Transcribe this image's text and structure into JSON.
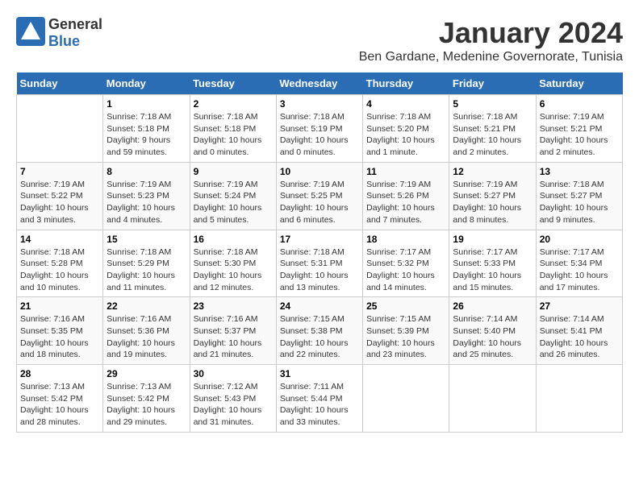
{
  "header": {
    "logo_general": "General",
    "logo_blue": "Blue",
    "month_title": "January 2024",
    "location": "Ben Gardane, Medenine Governorate, Tunisia"
  },
  "weekdays": [
    "Sunday",
    "Monday",
    "Tuesday",
    "Wednesday",
    "Thursday",
    "Friday",
    "Saturday"
  ],
  "weeks": [
    [
      {
        "day": "",
        "sunrise": "",
        "sunset": "",
        "daylight": ""
      },
      {
        "day": "1",
        "sunrise": "Sunrise: 7:18 AM",
        "sunset": "Sunset: 5:18 PM",
        "daylight": "Daylight: 9 hours and 59 minutes."
      },
      {
        "day": "2",
        "sunrise": "Sunrise: 7:18 AM",
        "sunset": "Sunset: 5:18 PM",
        "daylight": "Daylight: 10 hours and 0 minutes."
      },
      {
        "day": "3",
        "sunrise": "Sunrise: 7:18 AM",
        "sunset": "Sunset: 5:19 PM",
        "daylight": "Daylight: 10 hours and 0 minutes."
      },
      {
        "day": "4",
        "sunrise": "Sunrise: 7:18 AM",
        "sunset": "Sunset: 5:20 PM",
        "daylight": "Daylight: 10 hours and 1 minute."
      },
      {
        "day": "5",
        "sunrise": "Sunrise: 7:18 AM",
        "sunset": "Sunset: 5:21 PM",
        "daylight": "Daylight: 10 hours and 2 minutes."
      },
      {
        "day": "6",
        "sunrise": "Sunrise: 7:19 AM",
        "sunset": "Sunset: 5:21 PM",
        "daylight": "Daylight: 10 hours and 2 minutes."
      }
    ],
    [
      {
        "day": "7",
        "sunrise": "Sunrise: 7:19 AM",
        "sunset": "Sunset: 5:22 PM",
        "daylight": "Daylight: 10 hours and 3 minutes."
      },
      {
        "day": "8",
        "sunrise": "Sunrise: 7:19 AM",
        "sunset": "Sunset: 5:23 PM",
        "daylight": "Daylight: 10 hours and 4 minutes."
      },
      {
        "day": "9",
        "sunrise": "Sunrise: 7:19 AM",
        "sunset": "Sunset: 5:24 PM",
        "daylight": "Daylight: 10 hours and 5 minutes."
      },
      {
        "day": "10",
        "sunrise": "Sunrise: 7:19 AM",
        "sunset": "Sunset: 5:25 PM",
        "daylight": "Daylight: 10 hours and 6 minutes."
      },
      {
        "day": "11",
        "sunrise": "Sunrise: 7:19 AM",
        "sunset": "Sunset: 5:26 PM",
        "daylight": "Daylight: 10 hours and 7 minutes."
      },
      {
        "day": "12",
        "sunrise": "Sunrise: 7:19 AM",
        "sunset": "Sunset: 5:27 PM",
        "daylight": "Daylight: 10 hours and 8 minutes."
      },
      {
        "day": "13",
        "sunrise": "Sunrise: 7:18 AM",
        "sunset": "Sunset: 5:27 PM",
        "daylight": "Daylight: 10 hours and 9 minutes."
      }
    ],
    [
      {
        "day": "14",
        "sunrise": "Sunrise: 7:18 AM",
        "sunset": "Sunset: 5:28 PM",
        "daylight": "Daylight: 10 hours and 10 minutes."
      },
      {
        "day": "15",
        "sunrise": "Sunrise: 7:18 AM",
        "sunset": "Sunset: 5:29 PM",
        "daylight": "Daylight: 10 hours and 11 minutes."
      },
      {
        "day": "16",
        "sunrise": "Sunrise: 7:18 AM",
        "sunset": "Sunset: 5:30 PM",
        "daylight": "Daylight: 10 hours and 12 minutes."
      },
      {
        "day": "17",
        "sunrise": "Sunrise: 7:18 AM",
        "sunset": "Sunset: 5:31 PM",
        "daylight": "Daylight: 10 hours and 13 minutes."
      },
      {
        "day": "18",
        "sunrise": "Sunrise: 7:17 AM",
        "sunset": "Sunset: 5:32 PM",
        "daylight": "Daylight: 10 hours and 14 minutes."
      },
      {
        "day": "19",
        "sunrise": "Sunrise: 7:17 AM",
        "sunset": "Sunset: 5:33 PM",
        "daylight": "Daylight: 10 hours and 15 minutes."
      },
      {
        "day": "20",
        "sunrise": "Sunrise: 7:17 AM",
        "sunset": "Sunset: 5:34 PM",
        "daylight": "Daylight: 10 hours and 17 minutes."
      }
    ],
    [
      {
        "day": "21",
        "sunrise": "Sunrise: 7:16 AM",
        "sunset": "Sunset: 5:35 PM",
        "daylight": "Daylight: 10 hours and 18 minutes."
      },
      {
        "day": "22",
        "sunrise": "Sunrise: 7:16 AM",
        "sunset": "Sunset: 5:36 PM",
        "daylight": "Daylight: 10 hours and 19 minutes."
      },
      {
        "day": "23",
        "sunrise": "Sunrise: 7:16 AM",
        "sunset": "Sunset: 5:37 PM",
        "daylight": "Daylight: 10 hours and 21 minutes."
      },
      {
        "day": "24",
        "sunrise": "Sunrise: 7:15 AM",
        "sunset": "Sunset: 5:38 PM",
        "daylight": "Daylight: 10 hours and 22 minutes."
      },
      {
        "day": "25",
        "sunrise": "Sunrise: 7:15 AM",
        "sunset": "Sunset: 5:39 PM",
        "daylight": "Daylight: 10 hours and 23 minutes."
      },
      {
        "day": "26",
        "sunrise": "Sunrise: 7:14 AM",
        "sunset": "Sunset: 5:40 PM",
        "daylight": "Daylight: 10 hours and 25 minutes."
      },
      {
        "day": "27",
        "sunrise": "Sunrise: 7:14 AM",
        "sunset": "Sunset: 5:41 PM",
        "daylight": "Daylight: 10 hours and 26 minutes."
      }
    ],
    [
      {
        "day": "28",
        "sunrise": "Sunrise: 7:13 AM",
        "sunset": "Sunset: 5:42 PM",
        "daylight": "Daylight: 10 hours and 28 minutes."
      },
      {
        "day": "29",
        "sunrise": "Sunrise: 7:13 AM",
        "sunset": "Sunset: 5:42 PM",
        "daylight": "Daylight: 10 hours and 29 minutes."
      },
      {
        "day": "30",
        "sunrise": "Sunrise: 7:12 AM",
        "sunset": "Sunset: 5:43 PM",
        "daylight": "Daylight: 10 hours and 31 minutes."
      },
      {
        "day": "31",
        "sunrise": "Sunrise: 7:11 AM",
        "sunset": "Sunset: 5:44 PM",
        "daylight": "Daylight: 10 hours and 33 minutes."
      },
      {
        "day": "",
        "sunrise": "",
        "sunset": "",
        "daylight": ""
      },
      {
        "day": "",
        "sunrise": "",
        "sunset": "",
        "daylight": ""
      },
      {
        "day": "",
        "sunrise": "",
        "sunset": "",
        "daylight": ""
      }
    ]
  ]
}
